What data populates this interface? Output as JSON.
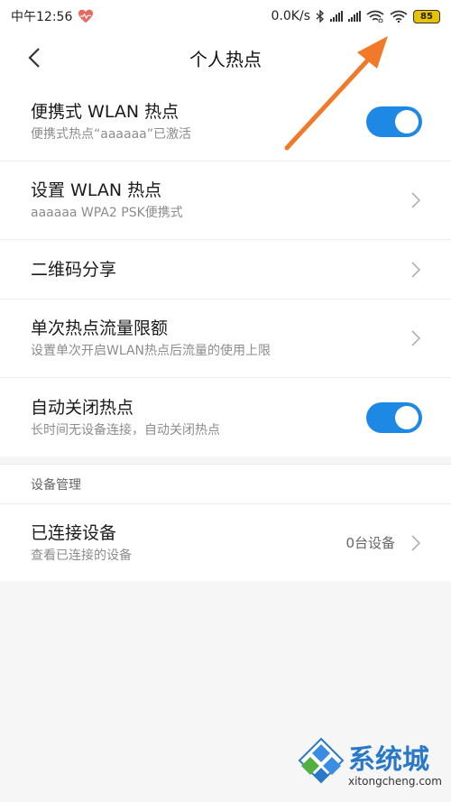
{
  "status_bar": {
    "time": "中午12:56",
    "speed": "0.0K/s",
    "battery": "85"
  },
  "nav": {
    "title": "个人热点"
  },
  "rows": [
    {
      "title": "便携式 WLAN 热点",
      "subtitle": "便携式热点“aaaaaa”已激活",
      "control": "toggle",
      "on": true
    },
    {
      "title": "设置 WLAN 热点",
      "subtitle": "aaaaaa WPA2 PSK便携式",
      "control": "chevron"
    },
    {
      "title": "二维码分享",
      "subtitle": "",
      "control": "chevron"
    },
    {
      "title": "单次热点流量限额",
      "subtitle": "设置单次开启WLAN热点后流量的使用上限",
      "control": "chevron"
    },
    {
      "title": "自动关闭热点",
      "subtitle": "长时间无设备连接，自动关闭热点",
      "control": "toggle",
      "on": true
    }
  ],
  "section": {
    "header": "设备管理",
    "device_row": {
      "title": "已连接设备",
      "subtitle": "查看已连接的设备",
      "value": "0台设备"
    }
  },
  "watermark": {
    "brand": "系统城",
    "url": "xitongcheng.com"
  },
  "colors": {
    "accent": "#1e88e5",
    "annotation_arrow": "#f07a2a"
  }
}
